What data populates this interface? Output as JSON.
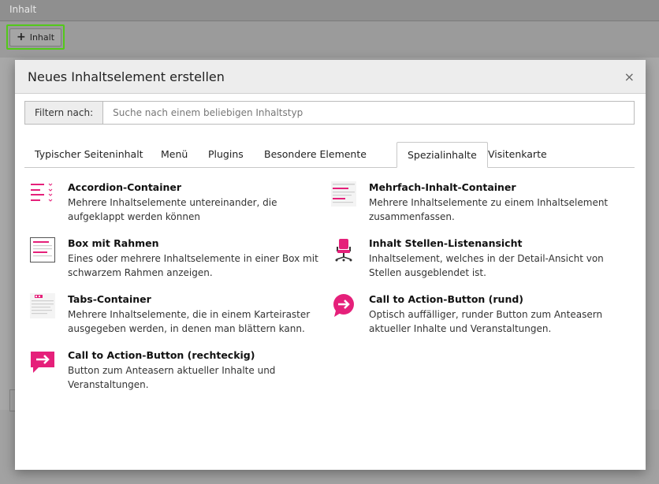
{
  "background": {
    "section_label": "Inhalt",
    "add_button_label": "Inhalt"
  },
  "modal": {
    "title": "Neues Inhaltselement erstellen",
    "close_symbol": "×",
    "filter": {
      "label": "Filtern nach:",
      "placeholder": "Suche nach einem beliebigen Inhaltstyp",
      "value": ""
    },
    "tabs": [
      {
        "label": "Typischer Seiteninhalt"
      },
      {
        "label": "Menü"
      },
      {
        "label": "Plugins"
      },
      {
        "label": "Besondere Elemente"
      },
      {
        "label": "Spezialinhalte",
        "active": true
      },
      {
        "label": "Visitenkarte"
      }
    ],
    "elements": [
      {
        "title": "Accordion-Container",
        "description": "Mehrere Inhaltselemente untereinander, die aufgeklappt werden können",
        "icon": "accordion-icon"
      },
      {
        "title": "Mehrfach-Inhalt-Container",
        "description": "Mehrere Inhaltselemente zu einem Inhaltselement zusammenfassen.",
        "icon": "multi-content-icon"
      },
      {
        "title": "Box mit Rahmen",
        "description": "Eines oder mehrere Inhaltselemente in einer Box mit schwarzem Rahmen anzeigen.",
        "icon": "box-frame-icon"
      },
      {
        "title": "Inhalt Stellen-Listenansicht",
        "description": "Inhaltselement, welches in der Detail-Ansicht von Stellen ausgeblendet ist.",
        "icon": "office-chair-icon"
      },
      {
        "title": "Tabs-Container",
        "description": "Mehrere Inhaltselemente, die in einem Karteiraster ausgegeben werden, in denen man blättern kann.",
        "icon": "tabs-icon"
      },
      {
        "title": "Call to Action-Button (rund)",
        "description": "Optisch auffälliger, runder Button zum Anteasern aktueller Inhalte und Veranstaltungen.",
        "icon": "round-arrow-icon"
      },
      {
        "title": "Call to Action-Button (rechteckig)",
        "description": "Button zum Anteasern aktueller Inhalte und Veranstaltungen.",
        "icon": "square-arrow-icon"
      }
    ]
  },
  "colors": {
    "accent": "#e5207a",
    "highlight_border": "#53c91a"
  }
}
